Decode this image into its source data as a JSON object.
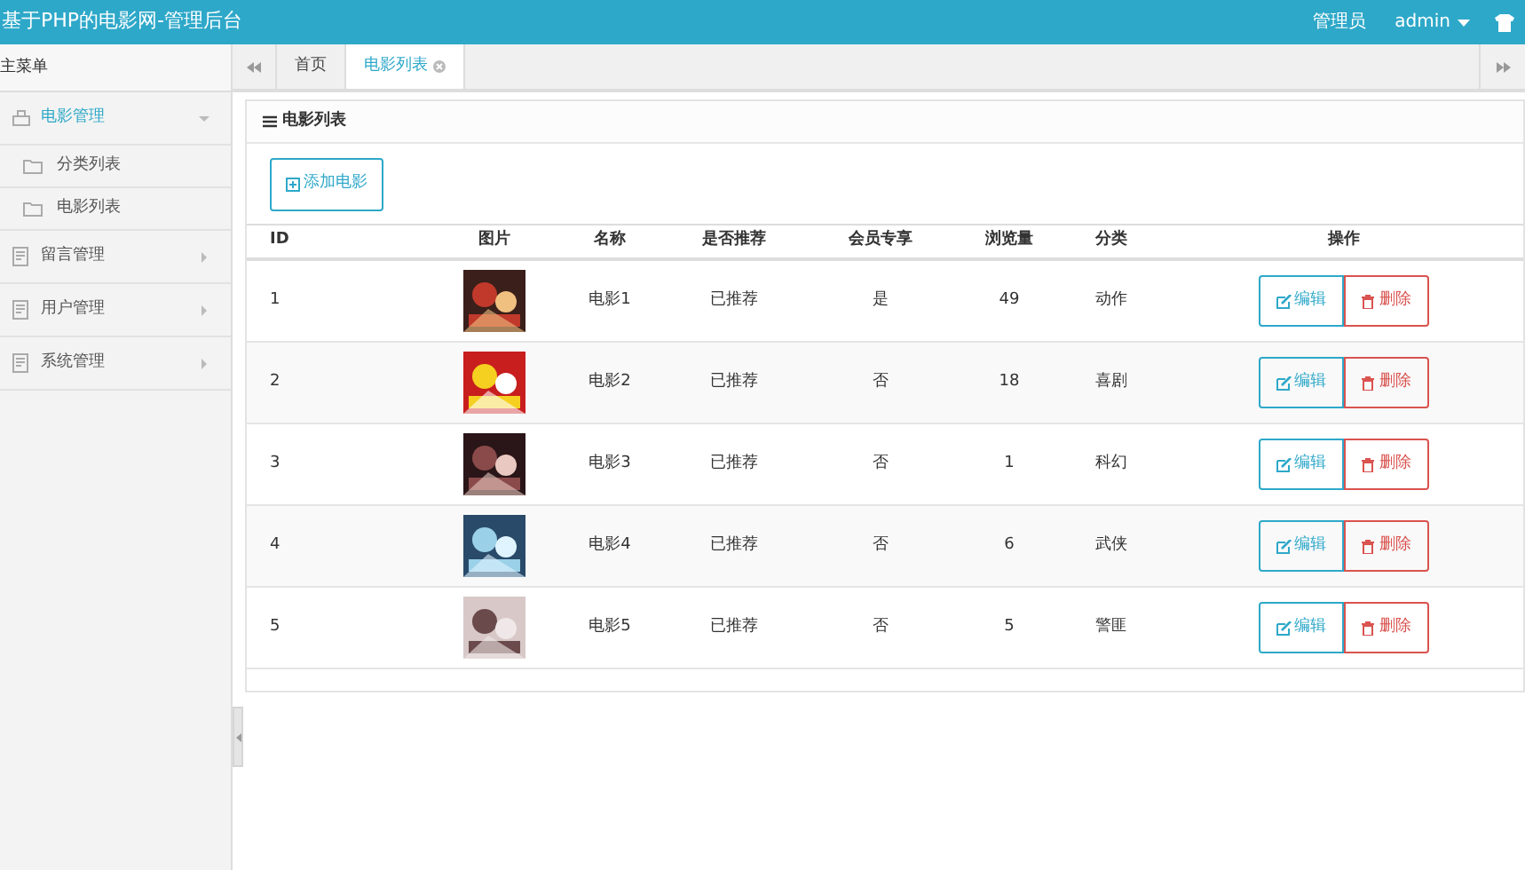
{
  "header": {
    "title": "基于PHP的电影网-管理后台",
    "role": "管理员",
    "user": "admin"
  },
  "sidebar": {
    "title": "主菜单",
    "items": [
      {
        "label": "电影管理",
        "expanded": true,
        "children": [
          {
            "label": "分类列表",
            "selected": false
          },
          {
            "label": "电影列表",
            "selected": false
          }
        ]
      },
      {
        "label": "留言管理",
        "expanded": false
      },
      {
        "label": "用户管理",
        "expanded": false
      },
      {
        "label": "系统管理",
        "expanded": false
      }
    ]
  },
  "tabs": [
    {
      "label": "首页",
      "selected": false,
      "closable": false
    },
    {
      "label": "电影列表",
      "selected": true,
      "closable": true
    }
  ],
  "panel": {
    "title": "电影列表",
    "add_button": "添加电影"
  },
  "table": {
    "columns": [
      "ID",
      "图片",
      "名称",
      "是否推荐",
      "会员专享",
      "浏览量",
      "分类",
      "操作"
    ],
    "rows": [
      {
        "id": "1",
        "name": "电影1",
        "recommended": "已推荐",
        "vip": "是",
        "views": "49",
        "category": "动作",
        "edit": "编辑",
        "delete": "删除"
      },
      {
        "id": "2",
        "name": "电影2",
        "recommended": "已推荐",
        "vip": "否",
        "views": "18",
        "category": "喜剧",
        "edit": "编辑",
        "delete": "删除"
      },
      {
        "id": "3",
        "name": "电影3",
        "recommended": "已推荐",
        "vip": "否",
        "views": "1",
        "category": "科幻",
        "edit": "编辑",
        "delete": "删除"
      },
      {
        "id": "4",
        "name": "电影4",
        "recommended": "已推荐",
        "vip": "否",
        "views": "6",
        "category": "武侠",
        "edit": "编辑",
        "delete": "删除"
      },
      {
        "id": "5",
        "name": "电影5",
        "recommended": "已推荐",
        "vip": "否",
        "views": "5",
        "category": "警匪",
        "edit": "编辑",
        "delete": "删除"
      }
    ]
  }
}
